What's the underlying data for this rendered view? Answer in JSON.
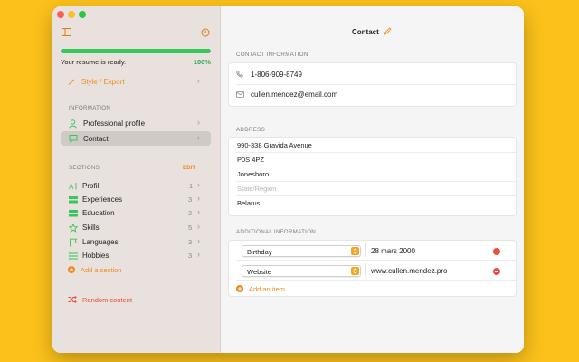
{
  "window": {
    "title": "Contact"
  },
  "sidebar": {
    "progress_label": "Your resume is ready.",
    "progress_value": "100%",
    "progress_fraction": 1.0,
    "style_export": "Style / Export",
    "information_header": "INFORMATION",
    "information_items": [
      {
        "label": "Professional profile",
        "icon": "person-icon"
      },
      {
        "label": "Contact",
        "icon": "chat-bubble-icon",
        "selected": true
      }
    ],
    "sections_header": "SECTIONS",
    "edit_label": "EDIT",
    "sections": [
      {
        "label": "Profil",
        "count": "1",
        "icon": "text-cursor-icon"
      },
      {
        "label": "Experiences",
        "count": "3",
        "icon": "stack-icon"
      },
      {
        "label": "Education",
        "count": "2",
        "icon": "stack-icon"
      },
      {
        "label": "Skills",
        "count": "5",
        "icon": "star-icon"
      },
      {
        "label": "Languages",
        "count": "3",
        "icon": "flag-icon"
      },
      {
        "label": "Hobbies",
        "count": "3",
        "icon": "list-icon"
      }
    ],
    "add_section": "Add a section",
    "random_content": "Random content"
  },
  "contact_info": {
    "header": "CONTACT INFORMATION",
    "phone": "1-806-909-8749",
    "email": "cullen.mendez@email.com"
  },
  "address": {
    "header": "ADDRESS",
    "street": "990-338 Gravida Avenue",
    "postal_code": "P0S 4PZ",
    "city": "Jonesboro",
    "region_placeholder": "State/Region",
    "country": "Belarus"
  },
  "additional": {
    "header": "ADDITIONAL INFORMATION",
    "items": [
      {
        "type": "Birthday",
        "value": "28 mars 2000"
      },
      {
        "type": "Website",
        "value": "www.cullen.mendez.pro"
      }
    ],
    "add_item": "Add an item"
  },
  "colors": {
    "accent": "#F08A1C",
    "green": "#34C759",
    "danger": "#EC4D3D",
    "background": "#FCC21B"
  }
}
